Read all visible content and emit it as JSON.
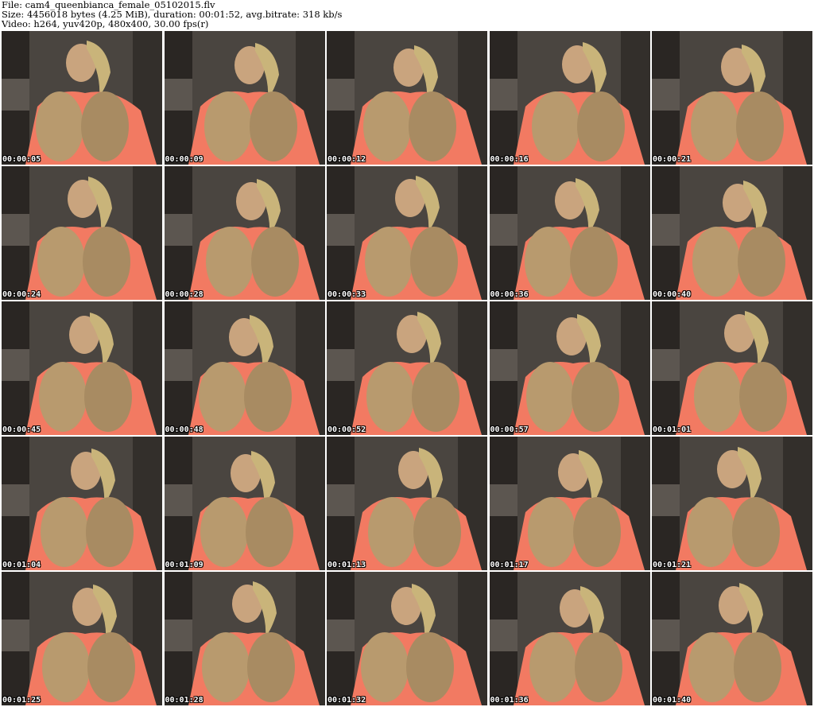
{
  "header": {
    "file_line": "File: cam4_queenbianca_female_05102015.flv",
    "size_line": "Size: 4456018 bytes (4.25 MiB), duration: 00:01:52, avg.bitrate: 318 kb/s",
    "video_line": "Video: h264, yuv420p, 480x400, 30.00 fps(r)"
  },
  "thumbnails": [
    {
      "timestamp": "00:00:05"
    },
    {
      "timestamp": "00:00:09"
    },
    {
      "timestamp": "00:00:12"
    },
    {
      "timestamp": "00:00:16"
    },
    {
      "timestamp": "00:00:21"
    },
    {
      "timestamp": "00:00:24"
    },
    {
      "timestamp": "00:00:28"
    },
    {
      "timestamp": "00:00:33"
    },
    {
      "timestamp": "00:00:36"
    },
    {
      "timestamp": "00:00:40"
    },
    {
      "timestamp": "00:00:45"
    },
    {
      "timestamp": "00:00:48"
    },
    {
      "timestamp": "00:00:52"
    },
    {
      "timestamp": "00:00:57"
    },
    {
      "timestamp": "00:01:01"
    },
    {
      "timestamp": "00:01:04"
    },
    {
      "timestamp": "00:01:09"
    },
    {
      "timestamp": "00:01:13"
    },
    {
      "timestamp": "00:01:17"
    },
    {
      "timestamp": "00:01:21"
    },
    {
      "timestamp": "00:01:25"
    },
    {
      "timestamp": "00:01:28"
    },
    {
      "timestamp": "00:01:32"
    },
    {
      "timestamp": "00:01:36"
    },
    {
      "timestamp": "00:01:40"
    }
  ],
  "colors": {
    "wall": "#4a4540",
    "shirt": "#f27a62",
    "skin": "#b89a6e",
    "hair": "#c9b47a",
    "timestamp_text": "#ffffff"
  }
}
